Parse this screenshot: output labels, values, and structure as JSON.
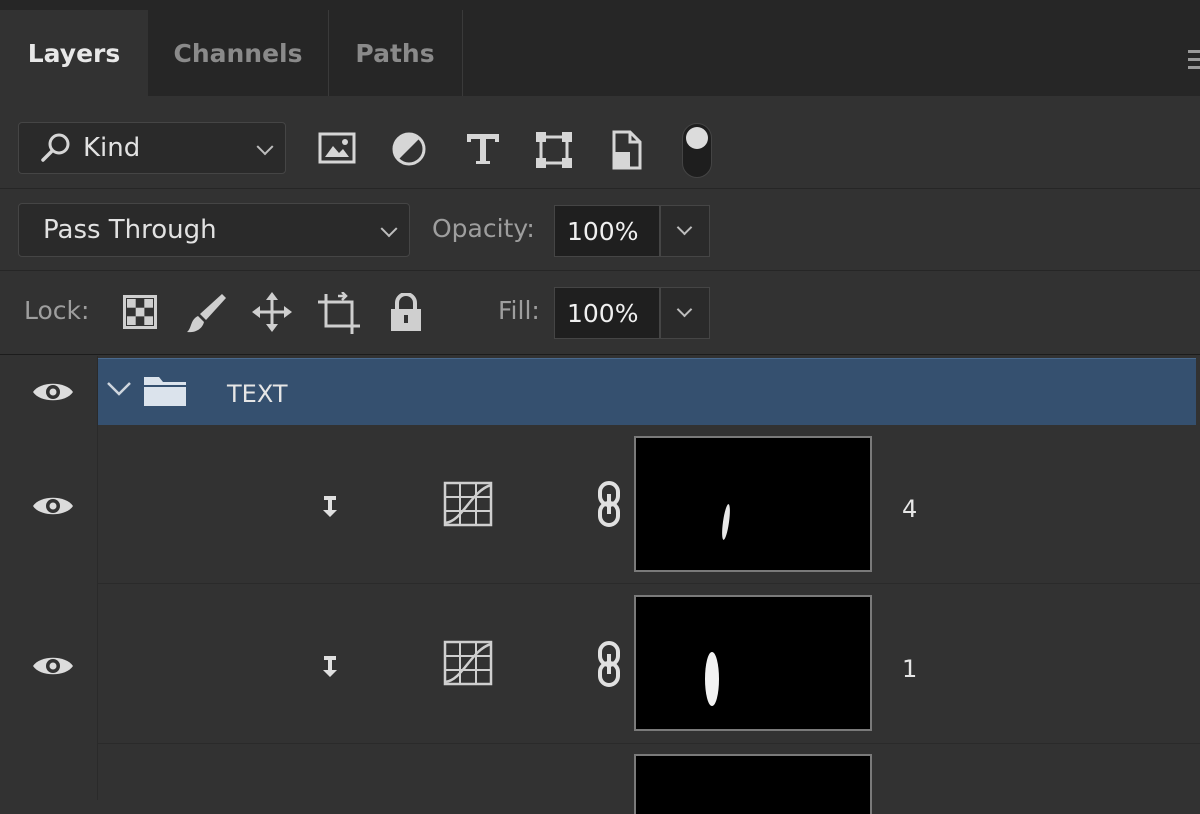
{
  "tabs": [
    {
      "label": "Layers",
      "active": true
    },
    {
      "label": "Channels",
      "active": false
    },
    {
      "label": "Paths",
      "active": false
    }
  ],
  "filter": {
    "kind_label": "Kind",
    "icons": [
      "search-icon",
      "image-filter-icon",
      "adjustment-filter-icon",
      "type-filter-icon",
      "shape-filter-icon",
      "smart-object-filter-icon",
      "filter-toggle-switch"
    ]
  },
  "blend": {
    "mode": "Pass Through",
    "opacity_label": "Opacity:",
    "opacity_value": "100%"
  },
  "lock": {
    "label": "Lock:",
    "icons": [
      "lock-transparent-pixels-icon",
      "lock-image-pixels-icon",
      "lock-position-icon",
      "lock-artboard-icon",
      "lock-all-icon"
    ],
    "fill_label": "Fill:",
    "fill_value": "100%"
  },
  "layers": [
    {
      "type": "group",
      "name": "TEXT",
      "visible": true,
      "expanded": true,
      "selected": true
    },
    {
      "type": "adjustment",
      "name": "4",
      "visible": true,
      "clipped": true,
      "linked_mask": true
    },
    {
      "type": "adjustment",
      "name": "1",
      "visible": true,
      "clipped": true,
      "linked_mask": true
    },
    {
      "type": "adjustment",
      "name": "",
      "visible": true,
      "clipped": true,
      "linked_mask": true
    }
  ],
  "colors": {
    "panel_bg": "#323232",
    "tab_bar_bg": "#262626",
    "selection": "#35506f",
    "text_primary": "#e6e6e6",
    "text_muted": "#9e9e9e"
  }
}
